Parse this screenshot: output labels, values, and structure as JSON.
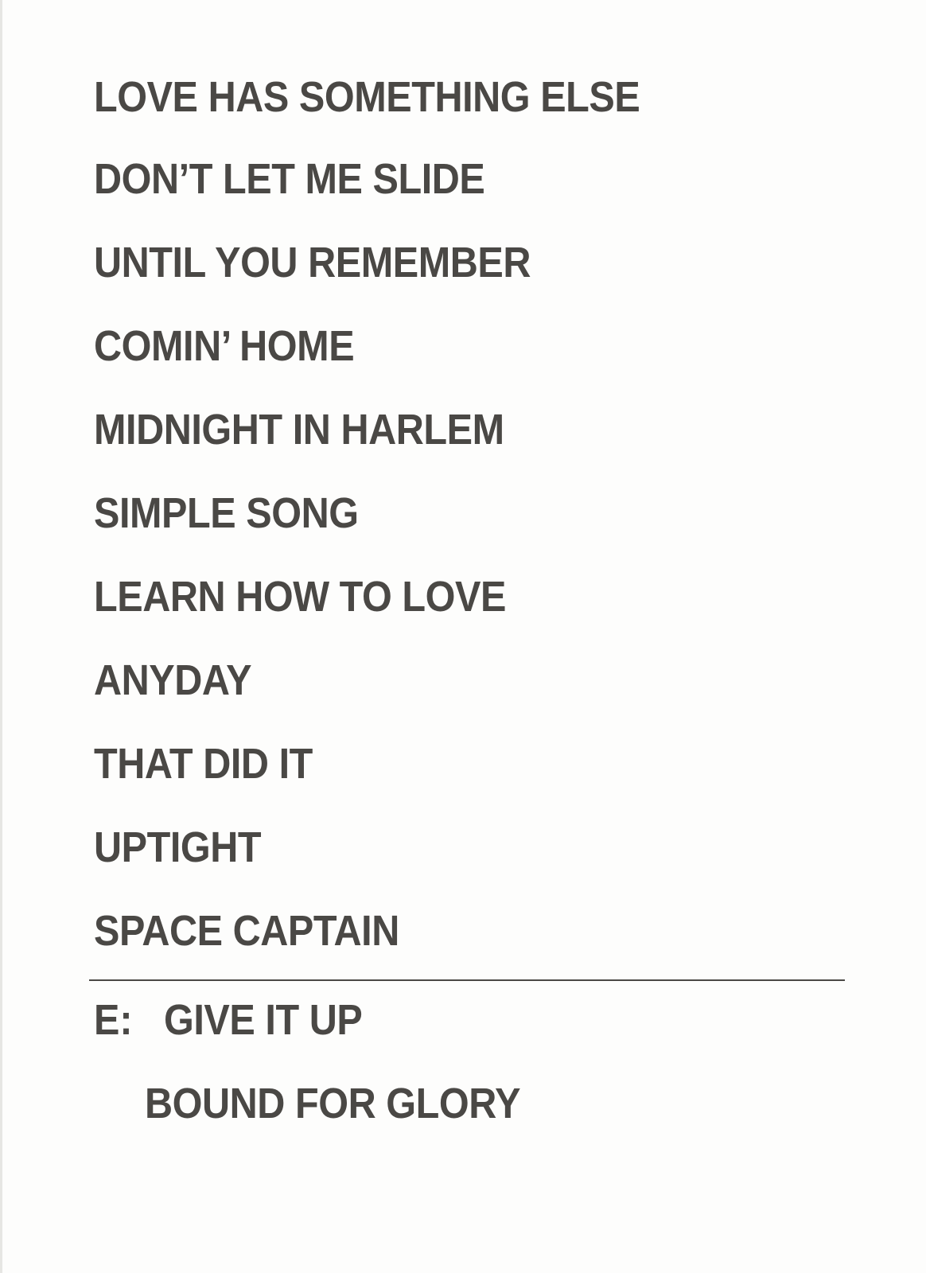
{
  "setlist": {
    "songs": [
      "LOVE HAS SOMETHING ELSE",
      "DON’T LET ME SLIDE",
      "UNTIL YOU REMEMBER",
      "COMIN’ HOME",
      "MIDNIGHT IN HARLEM",
      "SIMPLE SONG",
      "LEARN HOW TO LOVE",
      "ANYDAY",
      "THAT DID IT",
      "UPTIGHT",
      "SPACE CAPTAIN"
    ],
    "encore": {
      "label": "E:",
      "songs": [
        "GIVE IT UP",
        "BOUND FOR GLORY"
      ]
    }
  }
}
